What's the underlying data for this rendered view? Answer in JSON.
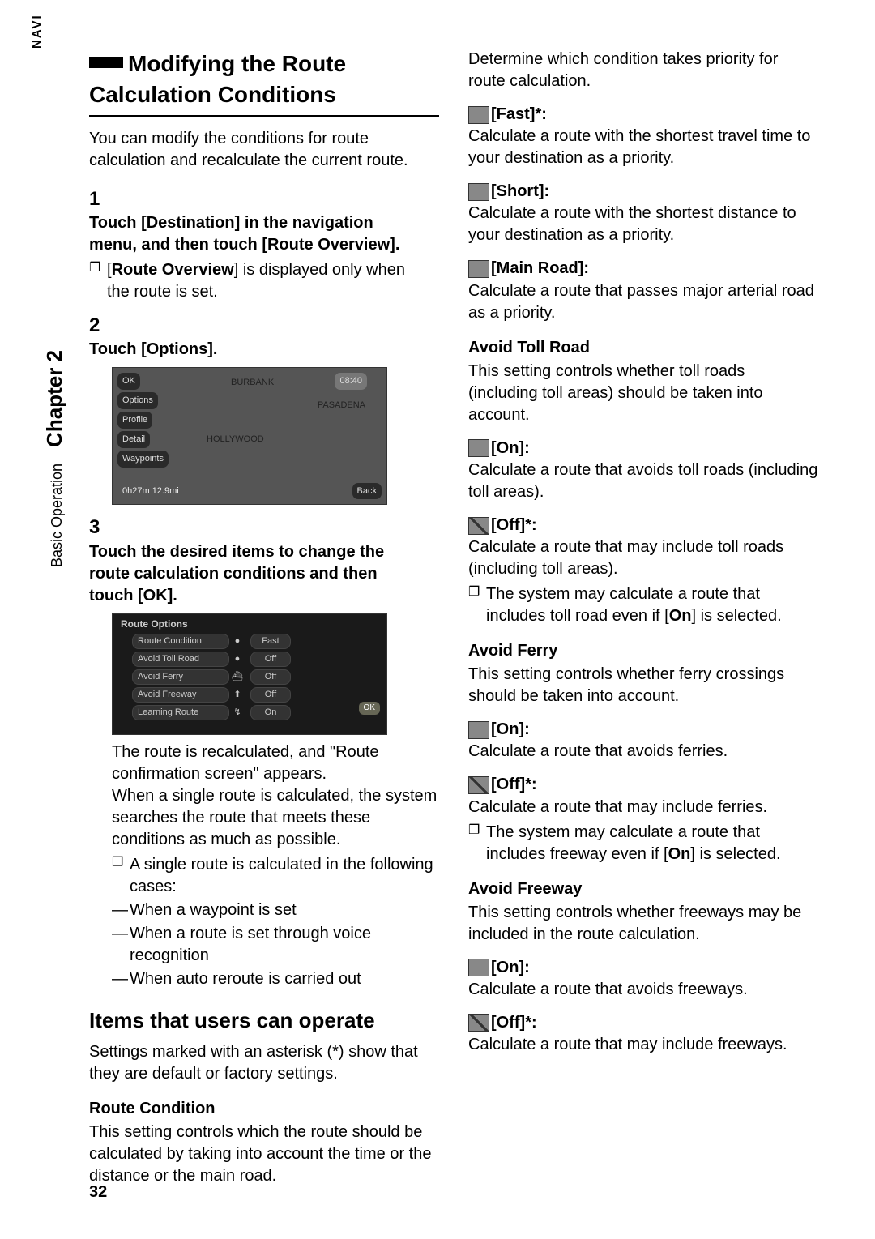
{
  "sidebar": {
    "navi": "NAVI",
    "section": "Basic Operation",
    "chapter_label": "Chapter 2"
  },
  "page_number": "32",
  "left": {
    "h1": "Modifying the Route Calculation Conditions",
    "intro": "You can modify the conditions for route calculation and recalculate the current route.",
    "steps": [
      {
        "num": "1",
        "head": "Touch [Destination] in the navigation menu, and then touch [Route Overview].",
        "note_pre": "[",
        "note_b": "Route Overview",
        "note_post": "] is displayed only when the route is set."
      },
      {
        "num": "2",
        "head": "Touch [Options]."
      },
      {
        "num": "3",
        "head": "Touch the desired items to change the route calculation conditions and then touch [OK]."
      }
    ],
    "screenshot1": {
      "ok": "OK",
      "options": "Options",
      "profile": "Profile",
      "detail": "Detail",
      "waypoints": "Waypoints",
      "back": "Back",
      "map_loc1": "BURBANK",
      "map_loc2": "PASADENA",
      "map_loc3": "HOLLYWOOD",
      "time": "08:40",
      "bottom": "0h27m   12.9mi"
    },
    "screenshot2": {
      "title": "Route Options",
      "rows": [
        {
          "name": "Route Condition",
          "val": "Fast"
        },
        {
          "name": "Avoid Toll Road",
          "val": "Off"
        },
        {
          "name": "Avoid Ferry",
          "val": "Off"
        },
        {
          "name": "Avoid Freeway",
          "val": "Off"
        },
        {
          "name": "Learning Route",
          "val": "On"
        }
      ],
      "ok": "OK"
    },
    "after_shot": "The route is recalculated, and \"Route confirmation screen\" appears.\nWhen a single route is calculated, the system searches the route that meets these conditions as much as possible.",
    "note2": "A single route is calculated in the following cases:",
    "dashes": [
      "When a waypoint is set",
      "When a route is set through voice recognition",
      "When auto reroute is carried out"
    ],
    "h2": "Items that users can operate",
    "h2_sub": "Settings marked with an asterisk (*) show that they are default or factory settings.",
    "rc_head": "Route Condition",
    "rc_body": "This setting controls which the route should be calculated by taking into account the time or the distance or the main road."
  },
  "right": {
    "lead": "Determine which condition takes priority for route calculation.",
    "fast_label": "[Fast]*:",
    "fast_body": "Calculate a route with the shortest travel time to your destination as a priority.",
    "short_label": "[Short]:",
    "short_body": "Calculate a route with the shortest distance to your destination as a priority.",
    "main_label": "[Main Road]:",
    "main_body": "Calculate a route that passes major arterial road as a priority.",
    "atr_head": "Avoid Toll Road",
    "atr_body": "This setting controls whether toll roads (including toll areas) should be taken into account.",
    "atr_on_label": "[On]:",
    "atr_on_body": "Calculate a route that avoids toll roads (including toll areas).",
    "atr_off_label": "[Off]*:",
    "atr_off_body": "Calculate a route that may include toll roads (including toll areas).",
    "atr_note_pre": "The system may calculate a route that includes toll road even if [",
    "atr_note_b": "On",
    "atr_note_post": "] is selected.",
    "af_head": "Avoid Ferry",
    "af_body": "This setting controls whether ferry crossings should be taken into account.",
    "af_on_label": "[On]:",
    "af_on_body": "Calculate a route that avoids ferries.",
    "af_off_label": "[Off]*:",
    "af_off_body": "Calculate a route that may include ferries.",
    "af_note_pre": "The system may calculate a route that includes freeway even if [",
    "af_note_b": "On",
    "af_note_post": "] is selected.",
    "afw_head": "Avoid Freeway",
    "afw_body": "This setting controls whether freeways may be included in the route calculation.",
    "afw_on_label": "[On]:",
    "afw_on_body": "Calculate a route that avoids freeways.",
    "afw_off_label": "[Off]*:",
    "afw_off_body": "Calculate a route that may include freeways."
  }
}
